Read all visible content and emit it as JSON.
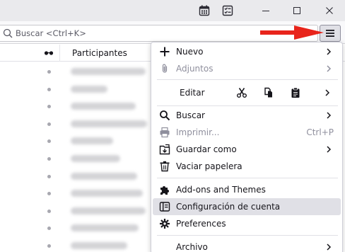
{
  "titlebar": {
    "icons": [
      "calendar-icon",
      "tasks-icon"
    ],
    "controls": [
      "minimize-icon",
      "maximize-icon",
      "close-icon"
    ]
  },
  "search": {
    "placeholder": "Buscar <Ctrl+K>"
  },
  "thread_pane": {
    "column_header": "Participantes",
    "row_count": 11
  },
  "menu": {
    "nuevo": "Nuevo",
    "adjuntos": "Adjuntos",
    "editar": "Editar",
    "buscar": "Buscar",
    "imprimir": "Imprimir...",
    "imprimir_shortcut": "Ctrl+P",
    "guardar_como": "Guardar como",
    "vaciar_papelera": "Vaciar papelera",
    "addons": "Add-ons and Themes",
    "configuracion": "Configuración de cuenta",
    "preferences": "Preferences",
    "archivo": "Archivo"
  },
  "colors": {
    "accent_arrow": "#e8241b",
    "hover_bg": "#e0e0e6",
    "disabled_text": "#8f8f9d"
  }
}
